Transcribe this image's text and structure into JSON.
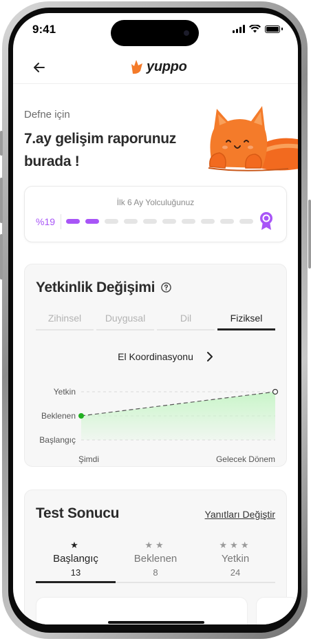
{
  "status_bar": {
    "time": "9:41"
  },
  "header": {
    "logo_text": "yuppo",
    "brand_color": "#f47b2a"
  },
  "hero": {
    "subtitle": "Defne için",
    "title": "7.ay gelişim raporunuz burada !"
  },
  "journey": {
    "title": "İlk 6 Ay Yolculuğunuz",
    "percent_label": "%19",
    "progress": 0.19,
    "steps_total": 10,
    "steps_done": 2,
    "accent_color": "#a855f7",
    "end_icon": "award-ribbon-icon"
  },
  "competency": {
    "title": "Yetkinlik Değişimi",
    "help_icon": "question-circle-icon",
    "tabs": [
      {
        "label": "Zihinsel",
        "active": false
      },
      {
        "label": "Duygusal",
        "active": false
      },
      {
        "label": "Dil",
        "active": false
      },
      {
        "label": "Fiziksel",
        "active": true
      }
    ],
    "skill": "El Koordinasyonu"
  },
  "chart_data": {
    "type": "area",
    "y_levels": [
      "Başlangıç",
      "Beklenen",
      "Yetkin"
    ],
    "x_labels": [
      "Şimdi",
      "Gelecek Dönem"
    ],
    "points": [
      {
        "x": "Şimdi",
        "level": "Beklenen"
      },
      {
        "x": "Gelecek Dönem",
        "level": "Yetkin"
      }
    ],
    "fill_color": "#c9f5c9",
    "line_color": "#555555",
    "start_point_color": "#22b022",
    "grid": true
  },
  "test": {
    "title": "Test Sonucu",
    "change_link": "Yanıtları Değiştir",
    "levels": [
      {
        "stars": "★",
        "name": "Başlangıç",
        "count": "13",
        "active": true
      },
      {
        "stars": "★★",
        "name": "Beklenen",
        "count": "8",
        "active": false
      },
      {
        "stars": "★★★",
        "name": "Yetkin",
        "count": "24",
        "active": false
      }
    ]
  }
}
